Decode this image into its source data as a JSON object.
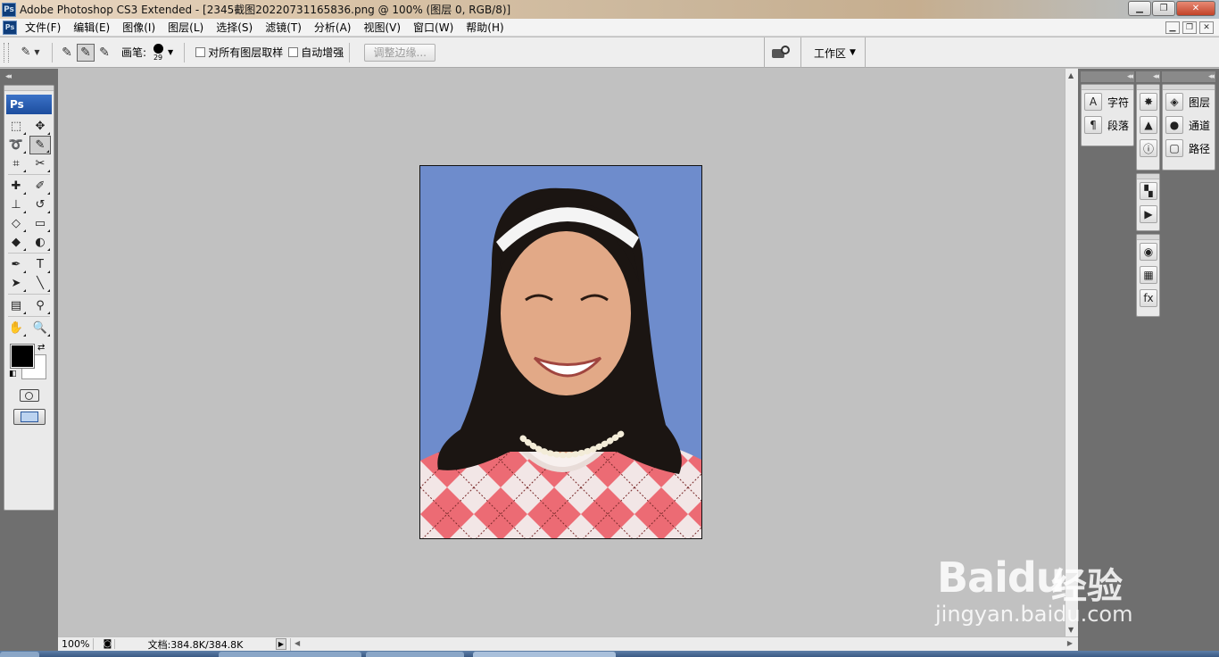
{
  "window": {
    "title": "Adobe Photoshop CS3 Extended - [2345截图20220731165836.png @ 100% (图层 0, RGB/8)]",
    "logo": "Ps",
    "controls": [
      "minimize",
      "restore",
      "close"
    ]
  },
  "menu": {
    "items": [
      "文件(F)",
      "编辑(E)",
      "图像(I)",
      "图层(L)",
      "选择(S)",
      "滤镜(T)",
      "分析(A)",
      "视图(V)",
      "窗口(W)",
      "帮助(H)"
    ]
  },
  "options": {
    "brush_label": "画笔:",
    "brush_size": "29",
    "sample_all_layers": "对所有图层取样",
    "auto_enhance": "自动增强",
    "refine_edge": "调整边缘...",
    "workspace": "工作区"
  },
  "toolbox": {
    "logo": "Ps",
    "selected_tool": "quick-selection-tool",
    "tools": [
      {
        "name": "marquee-tool",
        "glyph": "⬚"
      },
      {
        "name": "move-tool",
        "glyph": "✥"
      },
      {
        "name": "lasso-tool",
        "glyph": "➰"
      },
      {
        "name": "quick-selection-tool",
        "glyph": "✎"
      },
      {
        "name": "crop-tool",
        "glyph": "⌗"
      },
      {
        "name": "slice-tool",
        "glyph": "✂"
      },
      {
        "name": "healing-brush-tool",
        "glyph": "✚"
      },
      {
        "name": "brush-tool",
        "glyph": "✐"
      },
      {
        "name": "clone-stamp-tool",
        "glyph": "⊥"
      },
      {
        "name": "history-brush-tool",
        "glyph": "↺"
      },
      {
        "name": "eraser-tool",
        "glyph": "◇"
      },
      {
        "name": "gradient-tool",
        "glyph": "▭"
      },
      {
        "name": "blur-tool",
        "glyph": "◆"
      },
      {
        "name": "dodge-tool",
        "glyph": "◐"
      },
      {
        "name": "pen-tool",
        "glyph": "✒"
      },
      {
        "name": "type-tool",
        "glyph": "T"
      },
      {
        "name": "path-selection-tool",
        "glyph": "➤"
      },
      {
        "name": "line-tool",
        "glyph": "╲"
      },
      {
        "name": "notes-tool",
        "glyph": "▤"
      },
      {
        "name": "eyedropper-tool",
        "glyph": "⚲"
      },
      {
        "name": "hand-tool",
        "glyph": "✋"
      },
      {
        "name": "zoom-tool",
        "glyph": "🔍"
      }
    ],
    "foreground_color": "#000000",
    "background_color": "#ffffff"
  },
  "status": {
    "zoom": "100%",
    "doc_size": "文档:384.8K/384.8K"
  },
  "panels": {
    "col1": [
      {
        "icon": "character-icon",
        "glyph": "A",
        "label": "字符"
      },
      {
        "icon": "paragraph-icon",
        "glyph": "¶",
        "label": "段落"
      }
    ],
    "col2_groups": [
      [
        {
          "icon": "navigator-icon",
          "glyph": "✸"
        },
        {
          "icon": "histogram-icon",
          "glyph": "▲"
        },
        {
          "icon": "info-icon",
          "glyph": "ⓘ"
        }
      ],
      [
        {
          "icon": "brushes-icon",
          "glyph": "▚"
        },
        {
          "icon": "actions-icon",
          "glyph": "▶"
        }
      ],
      [
        {
          "icon": "color-icon",
          "glyph": "◉"
        },
        {
          "icon": "swatches-icon",
          "glyph": "▦"
        },
        {
          "icon": "styles-icon",
          "glyph": "fx"
        }
      ]
    ],
    "col3": [
      {
        "icon": "layers-icon",
        "glyph": "◈",
        "label": "图层"
      },
      {
        "icon": "channels-icon",
        "glyph": "●",
        "label": "通道"
      },
      {
        "icon": "paths-icon",
        "glyph": "▢",
        "label": "路径"
      }
    ]
  },
  "watermark": {
    "logo": "Baidu",
    "logo_cn": "经验",
    "url": "jingyan.baidu.com"
  },
  "colors": {
    "canvas_bg": "#c1c1c1",
    "dock_bg": "#6f6f6f",
    "photo_bg": "#6e8ccc"
  }
}
